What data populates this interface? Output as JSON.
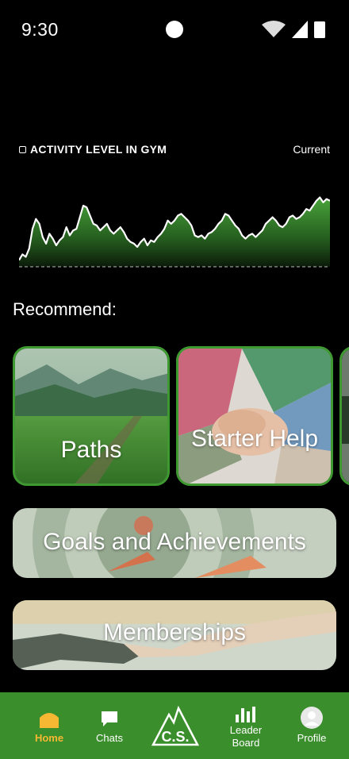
{
  "status_bar": {
    "time": "9:30"
  },
  "activity": {
    "title": "ACTIVITY LEVEL IN GYM",
    "current_label": "Current",
    "chart_data": {
      "type": "area",
      "values": [
        8,
        15,
        12,
        22,
        46,
        58,
        52,
        36,
        28,
        40,
        34,
        26,
        32,
        36,
        48,
        38,
        44,
        46,
        60,
        74,
        72,
        62,
        52,
        50,
        44,
        48,
        52,
        44,
        40,
        44,
        48,
        42,
        34,
        30,
        28,
        24,
        30,
        34,
        26,
        32,
        30,
        36,
        40,
        46,
        56,
        52,
        56,
        62,
        64,
        60,
        56,
        50,
        38,
        36,
        38,
        34,
        40,
        42,
        46,
        52,
        56,
        64,
        62,
        56,
        50,
        46,
        38,
        34,
        38,
        40,
        36,
        40,
        44,
        52,
        56,
        60,
        56,
        50,
        48,
        52,
        60,
        62,
        58,
        60,
        64,
        70,
        68,
        74,
        80,
        84,
        78,
        82,
        80
      ],
      "ylim": [
        0,
        100
      ]
    }
  },
  "recommend": {
    "title": "Recommend:",
    "cards": [
      {
        "label": "Paths"
      },
      {
        "label": "Starter Help"
      }
    ]
  },
  "wide_cards": [
    {
      "label": "Goals and Achievements"
    },
    {
      "label": "Memberships"
    }
  ],
  "nav": {
    "home": "Home",
    "chats": "Chats",
    "logo": "C.S.",
    "leaderboard": "Leader Board",
    "profile": "Profile"
  },
  "colors": {
    "accent_green": "#3b8e2c",
    "active_tab": "#f6b733",
    "chart_fill": "#3a8a30"
  }
}
